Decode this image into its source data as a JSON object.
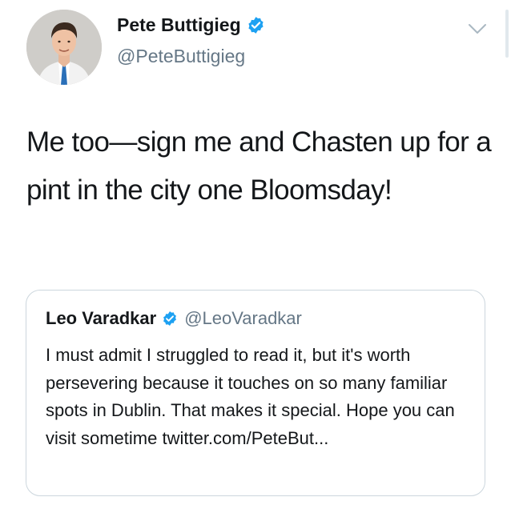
{
  "tweet": {
    "author": {
      "name": "Pete Buttigieg",
      "handle": "@PeteButtigieg",
      "verified_icon": "verified-badge-icon",
      "avatar": "profile-photo"
    },
    "menu_icon": "chevron-down-icon",
    "text": "Me too—sign me and Chasten up for a pint in the city one Bloomsday!"
  },
  "quote": {
    "author": {
      "name": "Leo Varadkar",
      "handle": "@LeoVaradkar",
      "verified_icon": "verified-badge-icon"
    },
    "text": "I must admit I struggled to read it, but it's worth persevering because it touches on so many familiar spots in Dublin. That makes it special. Hope you can visit sometime twitter.com/PeteBut..."
  },
  "colors": {
    "text": "#14171a",
    "secondary": "#657786",
    "verified": "#1da1f2",
    "border": "#ccd6dd"
  }
}
